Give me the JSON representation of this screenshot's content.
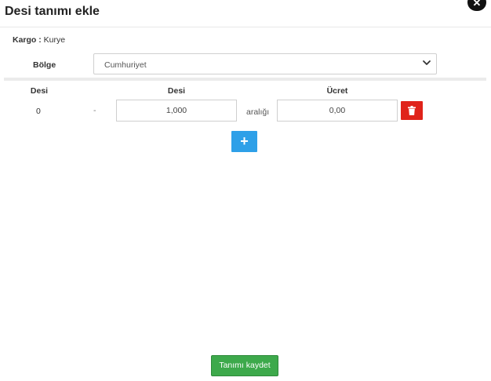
{
  "modal": {
    "title": "Desi tanımı ekle",
    "close_glyph": "✕"
  },
  "cargo": {
    "label": "Kargo :",
    "value": "Kurye"
  },
  "region": {
    "label": "Bölge",
    "selected": "Cumhuriyet"
  },
  "table": {
    "headers": [
      "Desi",
      "Desi",
      "Ücret"
    ],
    "rows": [
      {
        "desi_start": "0",
        "separator": "-",
        "desi_end": "1,000",
        "range_label": "aralığı",
        "price": "0,00"
      }
    ]
  },
  "buttons": {
    "add": "+",
    "save": "Tanımı kaydet"
  },
  "colors": {
    "delete": "#e0231a",
    "add": "#2ea0e8",
    "save": "#3da94b"
  },
  "icons": {
    "close": "close-icon",
    "chevron": "chevron-down-icon",
    "delete": "trash-icon",
    "add": "plus-icon"
  }
}
